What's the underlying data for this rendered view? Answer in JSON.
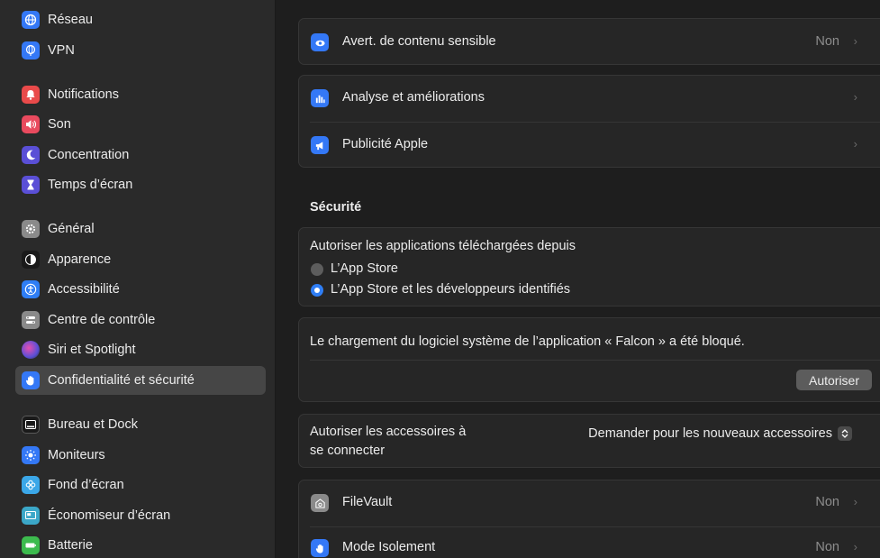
{
  "sidebar": {
    "items": [
      {
        "label": "Réseau",
        "icon": "globe-icon",
        "color": "#3478f6"
      },
      {
        "label": "VPN",
        "icon": "globe-lock-icon",
        "color": "#3478f6"
      },
      {
        "label": "Notifications",
        "icon": "bell-icon",
        "color": "#e94a4a"
      },
      {
        "label": "Son",
        "icon": "speaker-icon",
        "color": "#e94a5e"
      },
      {
        "label": "Concentration",
        "icon": "moon-icon",
        "color": "#5a4fd6"
      },
      {
        "label": "Temps d’écran",
        "icon": "hourglass-icon",
        "color": "#5a4fd6"
      },
      {
        "label": "Général",
        "icon": "gear-icon",
        "color": "#8a8a8a"
      },
      {
        "label": "Apparence",
        "icon": "appearance-icon",
        "color": "#1a1a1a"
      },
      {
        "label": "Accessibilité",
        "icon": "accessibility-icon",
        "color": "#2f7ef5"
      },
      {
        "label": "Centre de contrôle",
        "icon": "control-center-icon",
        "color": "#8a8a8a"
      },
      {
        "label": "Siri et Spotlight",
        "icon": "siri-icon",
        "color": "#9b59d0"
      },
      {
        "label": "Confidentialité et sécurité",
        "icon": "hand-icon",
        "color": "#3478f6"
      },
      {
        "label": "Bureau et Dock",
        "icon": "dock-icon",
        "color": "#1a1a1a"
      },
      {
        "label": "Moniteurs",
        "icon": "sun-icon",
        "color": "#3478f6"
      },
      {
        "label": "Fond d’écran",
        "icon": "flower-icon",
        "color": "#3ba7e8"
      },
      {
        "label": "Économiseur d’écran",
        "icon": "screensaver-icon",
        "color": "#3ba7c8"
      },
      {
        "label": "Batterie",
        "icon": "battery-icon",
        "color": "#3dbb4e"
      }
    ],
    "selected_index": 11
  },
  "main": {
    "sensitive": {
      "label": "Avert. de contenu sensible",
      "value": "Non",
      "icon": "eye-icon",
      "color": "#3478f6"
    },
    "analytics": {
      "label": "Analyse et améliorations",
      "icon": "bar-chart-icon",
      "color": "#3478f6"
    },
    "ads": {
      "label": "Publicité Apple",
      "icon": "megaphone-icon",
      "color": "#3478f6"
    },
    "security_title": "Sécurité",
    "allow_apps": {
      "label": "Autoriser les applications téléchargées depuis",
      "options": [
        "L’App Store",
        "L’App Store et les développeurs identifiés"
      ],
      "selected": 1
    },
    "blocked": {
      "message": "Le chargement du logiciel système de l’application « Falcon » a été bloqué.",
      "button": "Autoriser"
    },
    "accessories": {
      "label_line1": "Autoriser les accessoires à",
      "label_line2": "se connecter",
      "value": "Demander pour les nouveaux accessoires"
    },
    "filevault": {
      "label": "FileVault",
      "value": "Non",
      "icon": "vault-icon",
      "color": "#8a8a8a"
    },
    "lockdown": {
      "label": "Mode Isolement",
      "value": "Non",
      "icon": "hand-icon",
      "color": "#3478f6"
    }
  }
}
